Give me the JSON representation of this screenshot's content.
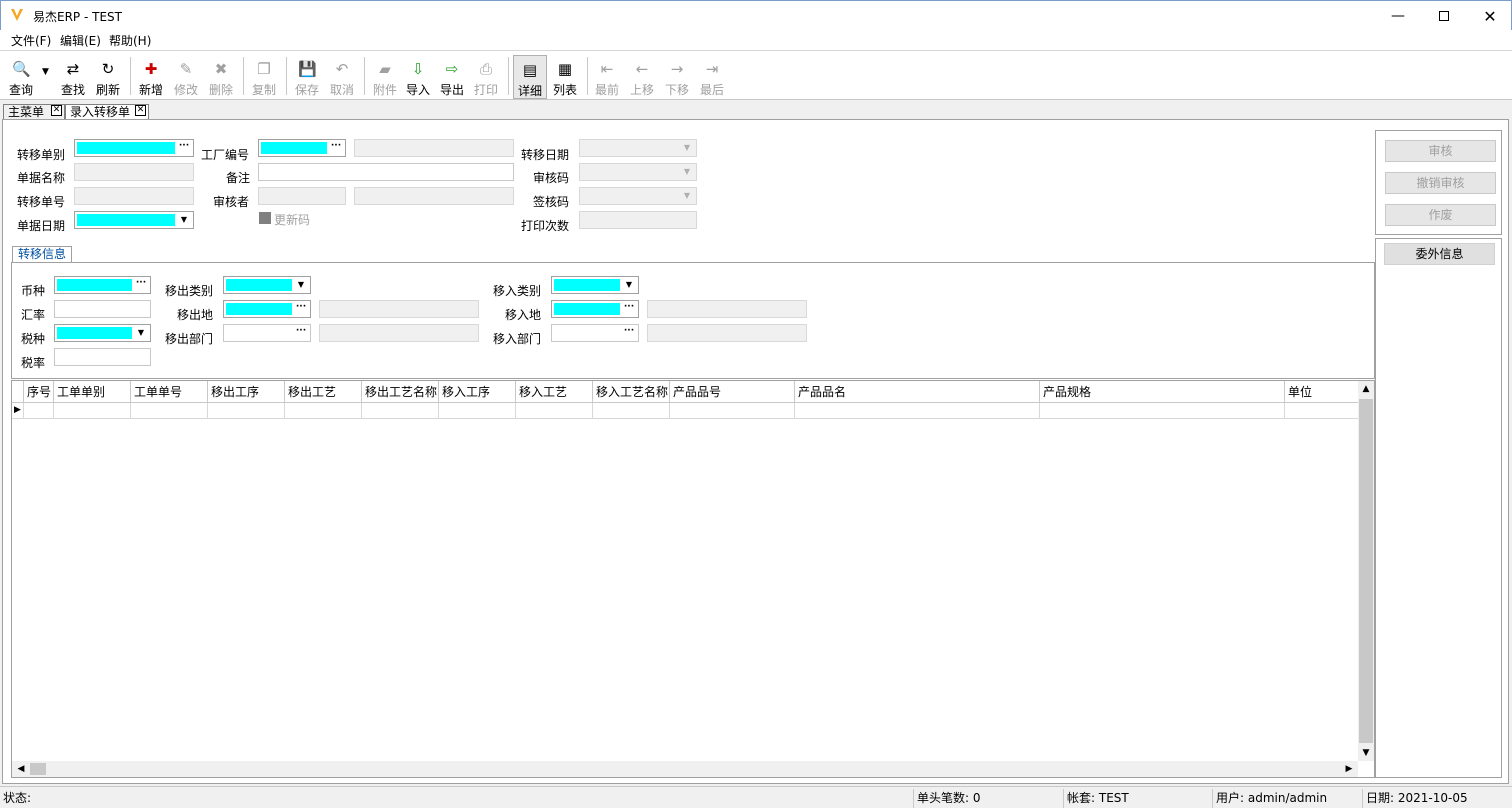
{
  "window": {
    "title": "易杰ERP - TEST"
  },
  "menu": [
    "文件(F)",
    "编辑(E)",
    "帮助(H)"
  ],
  "toolbar": {
    "query": "查询",
    "find": "查找",
    "refresh": "刷新",
    "new": "新增",
    "edit": "修改",
    "delete": "删除",
    "copy": "复制",
    "save": "保存",
    "cancel": "取消",
    "attach": "附件",
    "import": "导入",
    "export": "导出",
    "print": "打印",
    "detail": "详细",
    "list": "列表",
    "first": "最前",
    "prev": "上移",
    "next": "下移",
    "last": "最后"
  },
  "tabs": [
    "主菜单",
    "录入转移单"
  ],
  "header": {
    "doc_type_label": "转移单别",
    "factory_label": "工厂编号",
    "transfer_date_label": "转移日期",
    "doc_name_label": "单据名称",
    "remark_label": "备注",
    "audit_code_label": "审核码",
    "doc_no_label": "转移单号",
    "auditor_label": "审核者",
    "sign_code_label": "签核码",
    "doc_date_label": "单据日期",
    "update_code_label": "更新码",
    "print_count_label": "打印次数"
  },
  "side_buttons": {
    "audit": "审核",
    "unaudit": "撤销审核",
    "void": "作废",
    "outsource": "委外信息"
  },
  "group": {
    "title": "转移信息",
    "currency_label": "币种",
    "rate_label": "汇率",
    "tax_label": "税种",
    "tax_rate_label": "税率",
    "out_type_label": "移出类别",
    "out_place_label": "移出地",
    "out_dept_label": "移出部门",
    "in_type_label": "移入类别",
    "in_place_label": "移入地",
    "in_dept_label": "移入部门"
  },
  "grid": {
    "columns": [
      "序号",
      "工单单别",
      "工单单号",
      "移出工序",
      "移出工艺",
      "移出工艺名称",
      "移入工序",
      "移入工艺",
      "移入工艺名称",
      "产品品号",
      "产品品名",
      "产品规格",
      "单位"
    ]
  },
  "status": {
    "state": "状态:",
    "count": "单头笔数: 0",
    "account": "帐套: TEST",
    "user": "用户: admin/admin",
    "date": "日期: 2021-10-05"
  },
  "colors": {
    "required": "#00ffff",
    "accent": "#f5a623"
  }
}
